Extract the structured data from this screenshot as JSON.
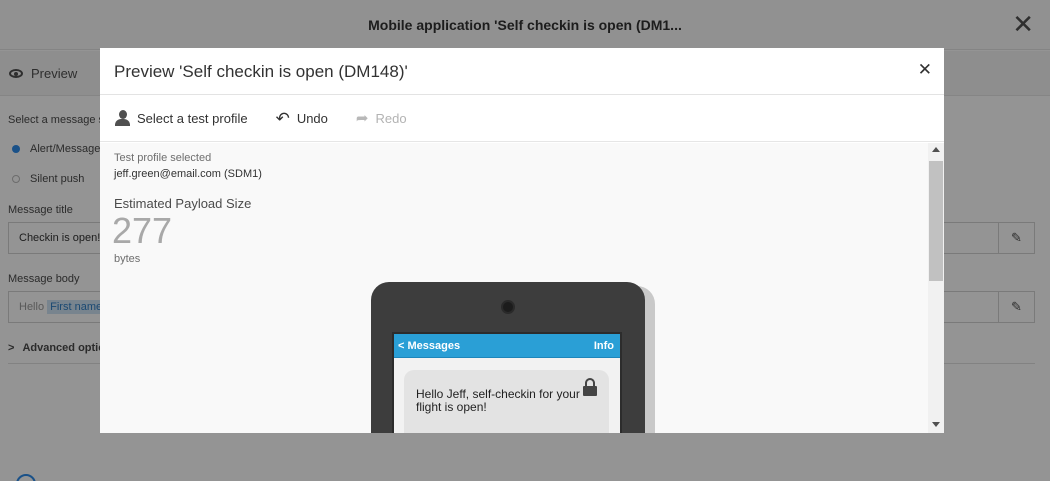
{
  "background": {
    "header_title": "Mobile application 'Self checkin is open (DM1...",
    "close_glyph": "✕",
    "preview_tab": "Preview",
    "select_message_label": "Select a message st",
    "option_alert": "Alert/Message",
    "option_silent": "Silent push",
    "message_title_label": "Message title",
    "message_title_value": "Checkin is open!",
    "message_body_label": "Message body",
    "message_body_prefix": "Hello",
    "message_body_chip": "First name",
    "advanced_label": "Advanced optio",
    "edit_glyph": "✎"
  },
  "modal": {
    "title": "Preview 'Self checkin is open (DM148)'",
    "close_glyph": "✕",
    "toolbar": {
      "select_profile": "Select a test profile",
      "undo": "Undo",
      "redo": "Redo"
    },
    "test_profile_label": "Test profile selected",
    "test_profile_value": "jeff.green@email.com (SDM1)",
    "payload_label": "Estimated Payload Size",
    "payload_value": "277",
    "payload_unit": "bytes",
    "phone": {
      "back_label": "< Messages",
      "info_label": "Info",
      "message_text": "Hello Jeff, self-checkin for your flight is open!"
    }
  },
  "colors": {
    "accent_blue": "#2a9fd6",
    "radio_selected": "#2d8ceb",
    "overlay": "rgba(0,0,0,0.42)"
  }
}
